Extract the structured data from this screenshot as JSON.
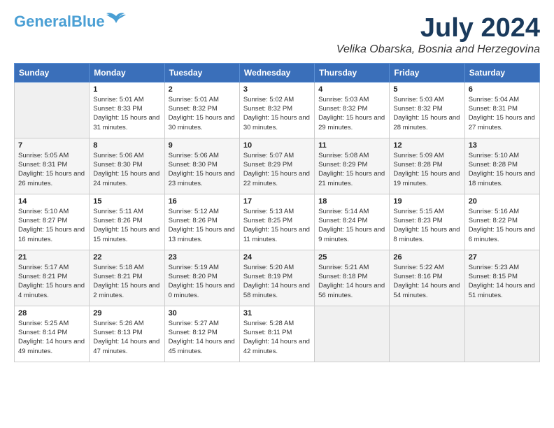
{
  "header": {
    "logo_line1": "General",
    "logo_line2": "Blue",
    "month_year": "July 2024",
    "location": "Velika Obarska, Bosnia and Herzegovina"
  },
  "weekdays": [
    "Sunday",
    "Monday",
    "Tuesday",
    "Wednesday",
    "Thursday",
    "Friday",
    "Saturday"
  ],
  "weeks": [
    [
      {
        "day": "",
        "sunrise": "",
        "sunset": "",
        "daylight": ""
      },
      {
        "day": "1",
        "sunrise": "Sunrise: 5:01 AM",
        "sunset": "Sunset: 8:33 PM",
        "daylight": "Daylight: 15 hours and 31 minutes."
      },
      {
        "day": "2",
        "sunrise": "Sunrise: 5:01 AM",
        "sunset": "Sunset: 8:32 PM",
        "daylight": "Daylight: 15 hours and 30 minutes."
      },
      {
        "day": "3",
        "sunrise": "Sunrise: 5:02 AM",
        "sunset": "Sunset: 8:32 PM",
        "daylight": "Daylight: 15 hours and 30 minutes."
      },
      {
        "day": "4",
        "sunrise": "Sunrise: 5:03 AM",
        "sunset": "Sunset: 8:32 PM",
        "daylight": "Daylight: 15 hours and 29 minutes."
      },
      {
        "day": "5",
        "sunrise": "Sunrise: 5:03 AM",
        "sunset": "Sunset: 8:32 PM",
        "daylight": "Daylight: 15 hours and 28 minutes."
      },
      {
        "day": "6",
        "sunrise": "Sunrise: 5:04 AM",
        "sunset": "Sunset: 8:31 PM",
        "daylight": "Daylight: 15 hours and 27 minutes."
      }
    ],
    [
      {
        "day": "7",
        "sunrise": "Sunrise: 5:05 AM",
        "sunset": "Sunset: 8:31 PM",
        "daylight": "Daylight: 15 hours and 26 minutes."
      },
      {
        "day": "8",
        "sunrise": "Sunrise: 5:06 AM",
        "sunset": "Sunset: 8:30 PM",
        "daylight": "Daylight: 15 hours and 24 minutes."
      },
      {
        "day": "9",
        "sunrise": "Sunrise: 5:06 AM",
        "sunset": "Sunset: 8:30 PM",
        "daylight": "Daylight: 15 hours and 23 minutes."
      },
      {
        "day": "10",
        "sunrise": "Sunrise: 5:07 AM",
        "sunset": "Sunset: 8:29 PM",
        "daylight": "Daylight: 15 hours and 22 minutes."
      },
      {
        "day": "11",
        "sunrise": "Sunrise: 5:08 AM",
        "sunset": "Sunset: 8:29 PM",
        "daylight": "Daylight: 15 hours and 21 minutes."
      },
      {
        "day": "12",
        "sunrise": "Sunrise: 5:09 AM",
        "sunset": "Sunset: 8:28 PM",
        "daylight": "Daylight: 15 hours and 19 minutes."
      },
      {
        "day": "13",
        "sunrise": "Sunrise: 5:10 AM",
        "sunset": "Sunset: 8:28 PM",
        "daylight": "Daylight: 15 hours and 18 minutes."
      }
    ],
    [
      {
        "day": "14",
        "sunrise": "Sunrise: 5:10 AM",
        "sunset": "Sunset: 8:27 PM",
        "daylight": "Daylight: 15 hours and 16 minutes."
      },
      {
        "day": "15",
        "sunrise": "Sunrise: 5:11 AM",
        "sunset": "Sunset: 8:26 PM",
        "daylight": "Daylight: 15 hours and 15 minutes."
      },
      {
        "day": "16",
        "sunrise": "Sunrise: 5:12 AM",
        "sunset": "Sunset: 8:26 PM",
        "daylight": "Daylight: 15 hours and 13 minutes."
      },
      {
        "day": "17",
        "sunrise": "Sunrise: 5:13 AM",
        "sunset": "Sunset: 8:25 PM",
        "daylight": "Daylight: 15 hours and 11 minutes."
      },
      {
        "day": "18",
        "sunrise": "Sunrise: 5:14 AM",
        "sunset": "Sunset: 8:24 PM",
        "daylight": "Daylight: 15 hours and 9 minutes."
      },
      {
        "day": "19",
        "sunrise": "Sunrise: 5:15 AM",
        "sunset": "Sunset: 8:23 PM",
        "daylight": "Daylight: 15 hours and 8 minutes."
      },
      {
        "day": "20",
        "sunrise": "Sunrise: 5:16 AM",
        "sunset": "Sunset: 8:22 PM",
        "daylight": "Daylight: 15 hours and 6 minutes."
      }
    ],
    [
      {
        "day": "21",
        "sunrise": "Sunrise: 5:17 AM",
        "sunset": "Sunset: 8:21 PM",
        "daylight": "Daylight: 15 hours and 4 minutes."
      },
      {
        "day": "22",
        "sunrise": "Sunrise: 5:18 AM",
        "sunset": "Sunset: 8:21 PM",
        "daylight": "Daylight: 15 hours and 2 minutes."
      },
      {
        "day": "23",
        "sunrise": "Sunrise: 5:19 AM",
        "sunset": "Sunset: 8:20 PM",
        "daylight": "Daylight: 15 hours and 0 minutes."
      },
      {
        "day": "24",
        "sunrise": "Sunrise: 5:20 AM",
        "sunset": "Sunset: 8:19 PM",
        "daylight": "Daylight: 14 hours and 58 minutes."
      },
      {
        "day": "25",
        "sunrise": "Sunrise: 5:21 AM",
        "sunset": "Sunset: 8:18 PM",
        "daylight": "Daylight: 14 hours and 56 minutes."
      },
      {
        "day": "26",
        "sunrise": "Sunrise: 5:22 AM",
        "sunset": "Sunset: 8:16 PM",
        "daylight": "Daylight: 14 hours and 54 minutes."
      },
      {
        "day": "27",
        "sunrise": "Sunrise: 5:23 AM",
        "sunset": "Sunset: 8:15 PM",
        "daylight": "Daylight: 14 hours and 51 minutes."
      }
    ],
    [
      {
        "day": "28",
        "sunrise": "Sunrise: 5:25 AM",
        "sunset": "Sunset: 8:14 PM",
        "daylight": "Daylight: 14 hours and 49 minutes."
      },
      {
        "day": "29",
        "sunrise": "Sunrise: 5:26 AM",
        "sunset": "Sunset: 8:13 PM",
        "daylight": "Daylight: 14 hours and 47 minutes."
      },
      {
        "day": "30",
        "sunrise": "Sunrise: 5:27 AM",
        "sunset": "Sunset: 8:12 PM",
        "daylight": "Daylight: 14 hours and 45 minutes."
      },
      {
        "day": "31",
        "sunrise": "Sunrise: 5:28 AM",
        "sunset": "Sunset: 8:11 PM",
        "daylight": "Daylight: 14 hours and 42 minutes."
      },
      {
        "day": "",
        "sunrise": "",
        "sunset": "",
        "daylight": ""
      },
      {
        "day": "",
        "sunrise": "",
        "sunset": "",
        "daylight": ""
      },
      {
        "day": "",
        "sunrise": "",
        "sunset": "",
        "daylight": ""
      }
    ]
  ]
}
